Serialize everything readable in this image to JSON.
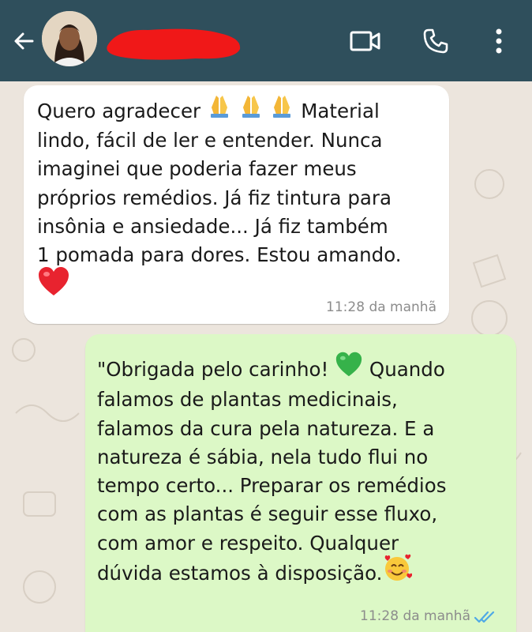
{
  "header": {
    "back_icon": "arrow-left-icon",
    "video_icon": "video-camera-icon",
    "call_icon": "phone-icon",
    "menu_icon": "kebab-menu-icon",
    "background": "#2f4f5c"
  },
  "messages": [
    {
      "direction": "incoming",
      "line1_a": "Quero agradecer ",
      "line1_b": " Material",
      "body": "lindo, fácil de ler e entender. Nunca\nimaginei que poderia fazer meus\npróprios remédios. Já fiz tintura para\ninsônia e ansiedade... Já fiz também\n1 pomada para dores. Estou amando.",
      "emojis": [
        "folded-hands-icon",
        "folded-hands-icon",
        "folded-hands-icon",
        "red-heart-icon"
      ],
      "time": "11:28 da manhã",
      "bubble_color": "#ffffff"
    },
    {
      "direction": "outgoing",
      "line1_a": "\"Obrigada pelo carinho! ",
      "line1_b": " Quando",
      "body": "falamos de plantas medicinais,\nfalamos da cura pela natureza. E a\nnatureza é sábia, nela tudo flui no\ntempo certo... Preparar os remédios\ncom as plantas é seguir esse fluxo,\ncom amor e respeito. Qualquer",
      "last_line": "dúvida estamos à disposição.",
      "emojis": [
        "green-heart-icon",
        "smiling-face-with-hearts-icon"
      ],
      "time": "11:28 da manhã",
      "status": "read",
      "bubble_color": "#dcf8c6"
    }
  ]
}
